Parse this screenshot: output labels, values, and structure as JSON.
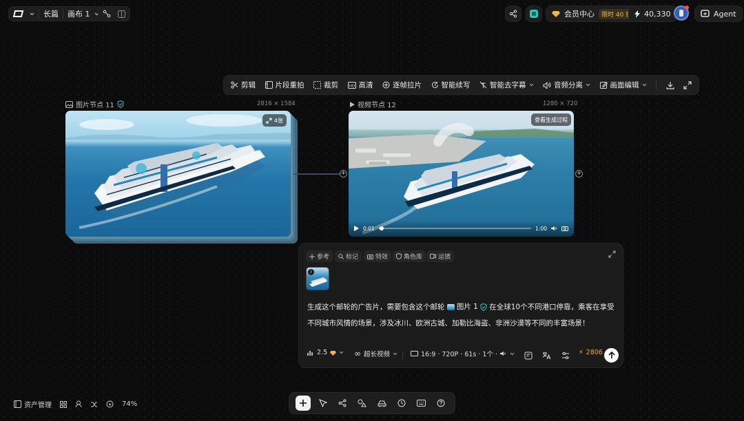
{
  "header": {
    "doc_name": "长篇",
    "canvas_name": "画布 1",
    "vip_label": "会员中心",
    "vip_badge": "限时 40 折",
    "credits": "40,330",
    "agent_label": "Agent"
  },
  "toolbar": {
    "tools": [
      "剪辑",
      "片段重拍",
      "裁剪",
      "高清",
      "逐帧拉片",
      "智能续写",
      "智能去字幕",
      "音频分离",
      "画面编辑"
    ]
  },
  "image_node": {
    "title": "图片节点 11",
    "dims": "2816 × 1584",
    "count_label": "4张"
  },
  "video_node": {
    "title": "视频节点 12",
    "dims": "1280 × 720",
    "view_process": "查看生成过程",
    "time_current": "0:01",
    "time_total": "1:00",
    "progress": 0.02
  },
  "panel": {
    "chips": [
      "参考",
      "标记",
      "特效",
      "角色库",
      "运镜"
    ],
    "prompt_before": "生成这个邮轮的广告片，需要包含这个邮轮",
    "ref_label": "图片 1",
    "prompt_after": "在全球10个不同港口停靠，乘客在享受不同城市风情的场景，涉及冰川、欧洲古城、加勒比海盗、非洲沙漠等不同的丰富场景！",
    "model_version": "2.5",
    "mode": "超长视频",
    "settings": "16:9 · 720P · 61s · 1个 ·",
    "cost": "2806"
  },
  "bottom": {
    "assets_label": "资产管理",
    "zoom": "74%"
  },
  "colors": {
    "accent_gold": "#f0b54a",
    "accent_teal": "#2ec4b6",
    "cost_orange": "#f5a524"
  }
}
